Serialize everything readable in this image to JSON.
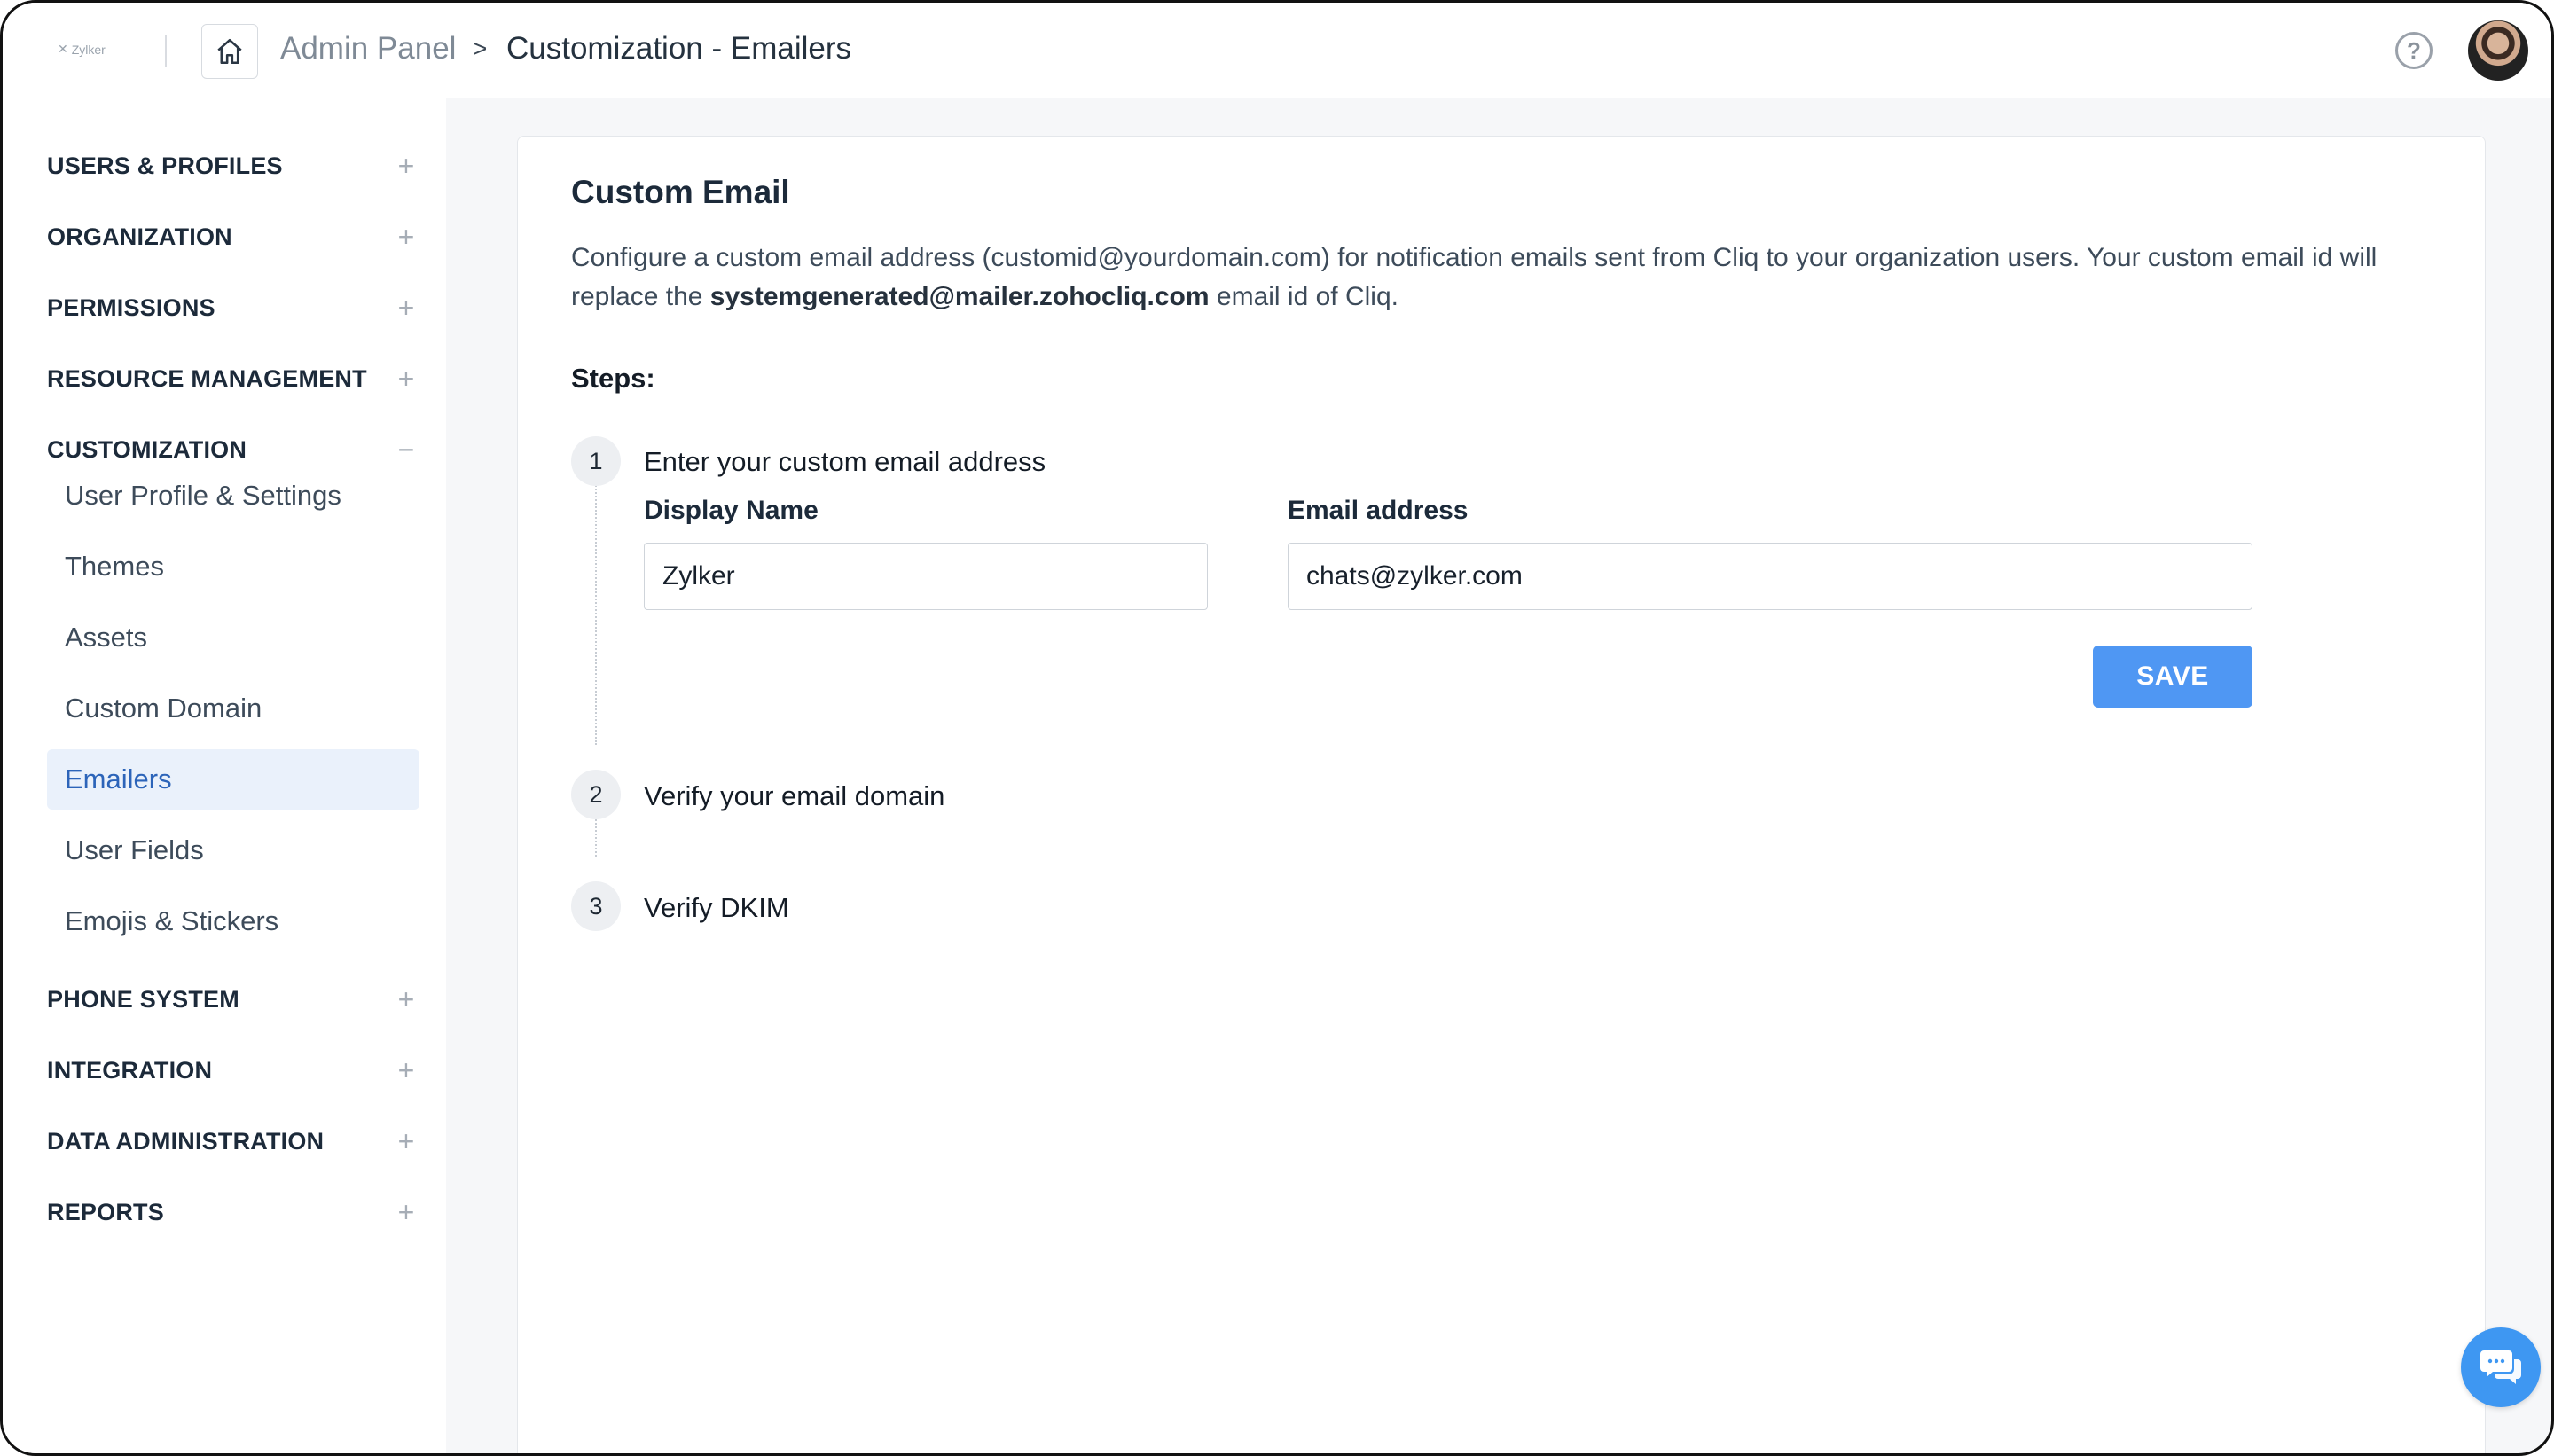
{
  "header": {
    "brand": "Zylker",
    "breadcrumb_root": "Admin Panel",
    "breadcrumb_sep": ">",
    "breadcrumb_current": "Customization - Emailers",
    "help_glyph": "?"
  },
  "sidebar": {
    "sections": [
      {
        "label": "USERS & PROFILES",
        "toggle": "+"
      },
      {
        "label": "ORGANIZATION",
        "toggle": "+"
      },
      {
        "label": "PERMISSIONS",
        "toggle": "+"
      },
      {
        "label": "RESOURCE MANAGEMENT",
        "toggle": "+"
      },
      {
        "label": "CUSTOMIZATION",
        "toggle": "−"
      },
      {
        "label": "PHONE SYSTEM",
        "toggle": "+"
      },
      {
        "label": "INTEGRATION",
        "toggle": "+"
      },
      {
        "label": "DATA ADMINISTRATION",
        "toggle": "+"
      },
      {
        "label": "REPORTS",
        "toggle": "+"
      }
    ],
    "customization_items": [
      {
        "label": "User Profile & Settings"
      },
      {
        "label": "Themes"
      },
      {
        "label": "Assets"
      },
      {
        "label": "Custom Domain"
      },
      {
        "label": "Emailers",
        "active": true
      },
      {
        "label": "User Fields"
      },
      {
        "label": "Emojis & Stickers"
      }
    ]
  },
  "main": {
    "title": "Custom Email",
    "desc_part1": "Configure a custom email address (customid@yourdomain.com) for notification emails sent from Cliq to your organization users. Your custom email id will replace the ",
    "desc_bold": "systemgenerated@mailer.zohocliq.com",
    "desc_part2": " email id of Cliq.",
    "steps_title": "Steps:",
    "steps": [
      {
        "num": "1",
        "label": "Enter your custom email address"
      },
      {
        "num": "2",
        "label": "Verify your email domain"
      },
      {
        "num": "3",
        "label": "Verify DKIM"
      }
    ],
    "display_name_label": "Display Name",
    "display_name_value": "Zylker",
    "email_label": "Email address",
    "email_value": "chats@zylker.com",
    "save_label": "SAVE"
  },
  "colors": {
    "accent": "#4f97f3",
    "active_bg": "#eaf1fb",
    "active_text": "#2c64b9",
    "chat_fab": "#3e97f2"
  },
  "icons": [
    "home-icon",
    "help-icon",
    "chat-bubble-icon"
  ]
}
